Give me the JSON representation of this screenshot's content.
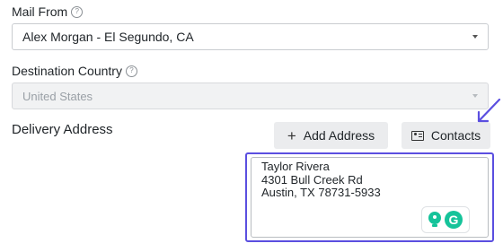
{
  "mail_from": {
    "label": "Mail From",
    "help_icon": "?",
    "value": "Alex Morgan - El Segundo, CA"
  },
  "destination_country": {
    "label": "Destination Country",
    "help_icon": "?",
    "value": "United States"
  },
  "delivery_address": {
    "title": "Delivery Address",
    "add_address_label": "Add Address",
    "add_address_icon": "+",
    "contacts_label": "Contacts",
    "address_lines": [
      "Taylor Rivera",
      "4301 Bull Creek Rd",
      "Austin, TX 78731-5933"
    ]
  },
  "grammarly": {
    "logo_letter": "G"
  },
  "colors": {
    "highlight": "#5b4fe0",
    "grammarly_green": "#15c39a",
    "button_bg": "#ebecee"
  }
}
